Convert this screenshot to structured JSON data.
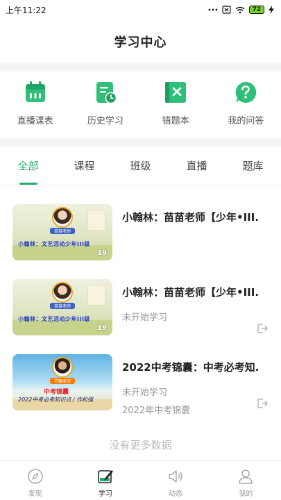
{
  "status_bar": {
    "time": "上午11:22",
    "signal": "••• ",
    "battery": "72"
  },
  "header": {
    "title": "学习中心"
  },
  "quick_actions": [
    {
      "label": "直播课表",
      "icon": "calendar-icon"
    },
    {
      "label": "历史学习",
      "icon": "history-icon"
    },
    {
      "label": "错题本",
      "icon": "wrong-book-icon"
    },
    {
      "label": "我的问答",
      "icon": "question-icon"
    }
  ],
  "tabs": [
    {
      "label": "全部",
      "active": true
    },
    {
      "label": "课程",
      "active": false
    },
    {
      "label": "班级",
      "active": false
    },
    {
      "label": "直播",
      "active": false
    },
    {
      "label": "题库",
      "active": false
    }
  ],
  "courses": [
    {
      "title": "小翰林：苗苗老师【少年•III...",
      "status": "",
      "tag": "",
      "thumb_plate": "苗苗老师",
      "thumb_caption": "小翰林：文艺活动少年III级",
      "thumb_count": "19"
    },
    {
      "title": "小翰林：苗苗老师【少年•III...",
      "status": "未开始学习",
      "tag": "",
      "thumb_plate": "苗苗老师",
      "thumb_caption": "小翰林：文艺活动少年III级",
      "thumb_count": "19"
    },
    {
      "title": "2022中考锦囊：中考必考知...",
      "status": "未开始学习",
      "tag": "2022年中考锦囊",
      "thumb_plate": "巧翰老师",
      "thumb_headline": "中考锦囊",
      "thumb_caption": "2022中考必考知识点 / 作松强"
    }
  ],
  "footer_text": "没有更多数据",
  "bottom_nav": [
    {
      "label": "发现",
      "icon": "compass-icon",
      "active": false
    },
    {
      "label": "学习",
      "icon": "study-icon",
      "active": true
    },
    {
      "label": "动态",
      "icon": "speaker-icon",
      "active": false
    },
    {
      "label": "我的",
      "icon": "person-icon",
      "active": false
    }
  ],
  "colors": {
    "accent": "#21b06a",
    "muted": "#999999",
    "background": "#f4f4f4"
  }
}
